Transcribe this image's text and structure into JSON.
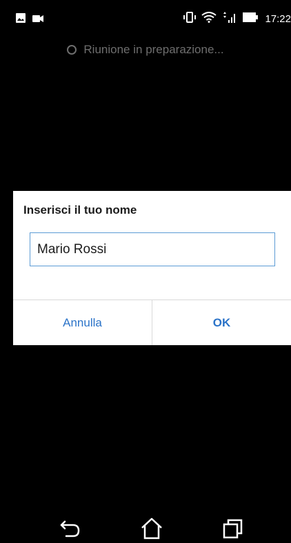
{
  "status_bar": {
    "time": "17:22",
    "left_icons": [
      "image-icon",
      "video-camera-icon"
    ],
    "right_icons": [
      "vibrate-icon",
      "wifi-icon",
      "signal-icon",
      "battery-icon"
    ]
  },
  "meeting": {
    "status_text": "Riunione in preparazione..."
  },
  "dialog": {
    "title": "Inserisci il tuo nome",
    "name_value": "Mario Rossi",
    "cancel_label": "Annulla",
    "ok_label": "OK"
  },
  "nav_bar": {
    "buttons": [
      "back-icon",
      "home-icon",
      "recents-icon"
    ]
  },
  "colors": {
    "background": "#000000",
    "dialog_background": "#ffffff",
    "accent": "#2b73c8",
    "input_border": "#5b9bd5",
    "status_text": "#6e6e6e"
  }
}
